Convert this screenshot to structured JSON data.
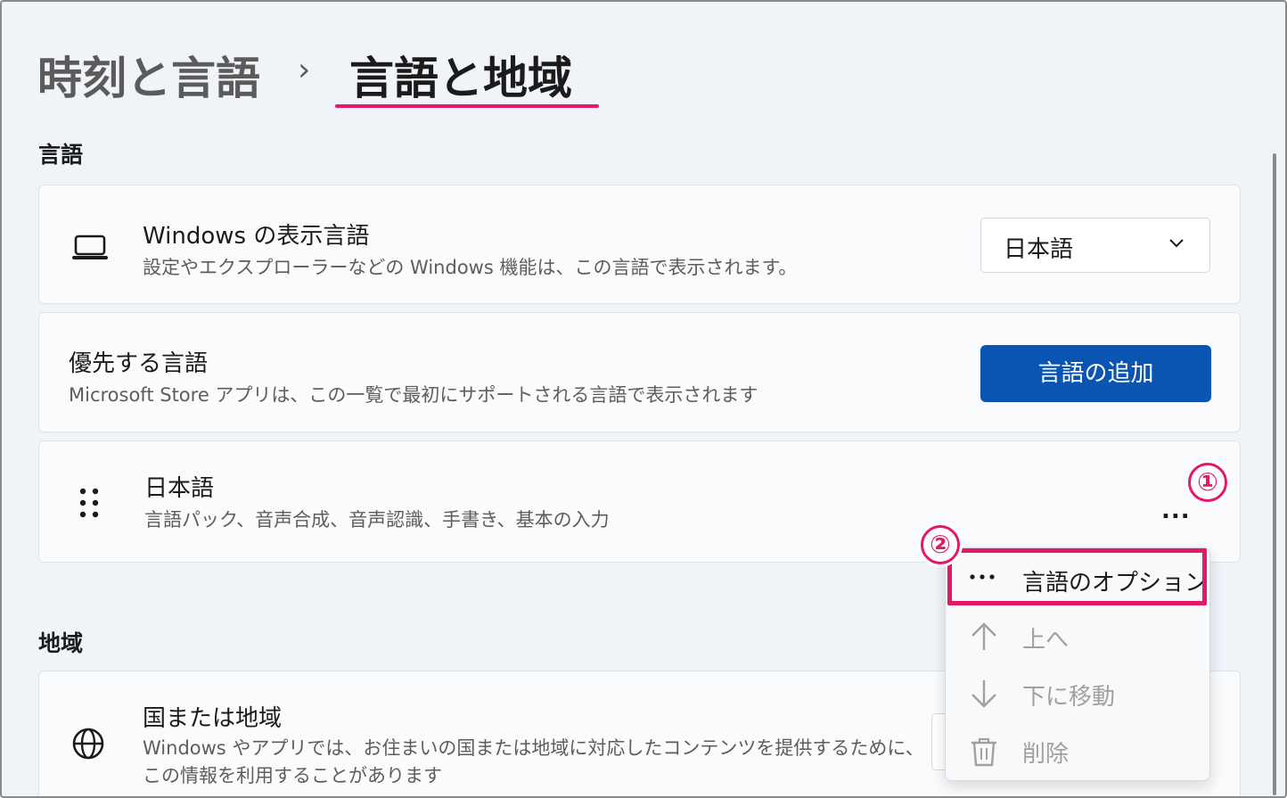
{
  "breadcrumb": {
    "parent": "時刻と言語",
    "separator": "›",
    "current": "言語と地域"
  },
  "language_section": {
    "title": "言語",
    "display_language": {
      "title": "Windows の表示言語",
      "description": "設定やエクスプローラーなどの Windows 機能は、この言語で表示されます。",
      "icon": "laptop-icon",
      "selected": "日本語"
    },
    "preferred_languages": {
      "title": "優先する言語",
      "description": "Microsoft Store アプリは、この一覧で最初にサポートされる言語で表示されます",
      "add_button": "言語の追加"
    },
    "japanese_item": {
      "title": "日本語",
      "description": "言語パック、音声合成、音声認識、手書き、基本の入力",
      "more_label": "..."
    }
  },
  "context_menu": {
    "items": [
      {
        "label": "言語のオプション",
        "icon": "more-horizontal-icon",
        "enabled": true
      },
      {
        "label": "上へ",
        "icon": "arrow-up-icon",
        "enabled": false
      },
      {
        "label": "下に移動",
        "icon": "arrow-down-icon",
        "enabled": false
      },
      {
        "label": "削除",
        "icon": "trash-icon",
        "enabled": false
      }
    ]
  },
  "region_section": {
    "title": "地域",
    "country_region": {
      "title": "国または地域",
      "description_line1": "Windows やアプリでは、お住まいの国または地域に対応したコンテンツを提供するために、",
      "description_line2": "この情報を利用することがあります",
      "icon": "globe-icon"
    }
  },
  "annotations": {
    "step1": "①",
    "step2": "②",
    "accent_color": "#e5176b"
  },
  "colors": {
    "primary_button": "#0a55b1",
    "background": "#f0f4f9"
  }
}
